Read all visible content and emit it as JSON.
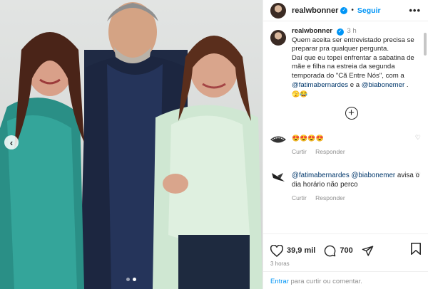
{
  "post": {
    "username": "realwbonner",
    "follow_label": "Seguir",
    "more_icon": "•••"
  },
  "caption": {
    "username": "realwbonner",
    "time": "3 h",
    "line1": "Quem aceita ser entrevistado precisa se preparar pra qualquer pergunta.",
    "line2": "Daí que eu topei enfrentar a sabatina de mãe e filha na estreia da segunda temporada do \"Cã Entre Nós\", com a",
    "mention1": "@fatimabernardes",
    "and": "e a",
    "mention2": "@biabonemer",
    "end_dot": ".",
    "emojis": "🫣😂"
  },
  "comments": [
    {
      "text": "😍😍😍😍",
      "reply_label": "Curtir",
      "reply2_label": "Responder"
    },
    {
      "mention1": "@fatimabernardes",
      "mention2": "@biabonemer",
      "text": "avisa o dia horário não perco",
      "reply_label": "Curtir",
      "reply2_label": "Responder"
    }
  ],
  "stats": {
    "likes": "39,9 mil",
    "comments": "700",
    "time_ago": "3 horas"
  },
  "add_comment": {
    "link": "Entrar",
    "rest": "para curtir ou comentar."
  },
  "colors": {
    "accent": "#0095f6",
    "mention": "#00376b"
  }
}
